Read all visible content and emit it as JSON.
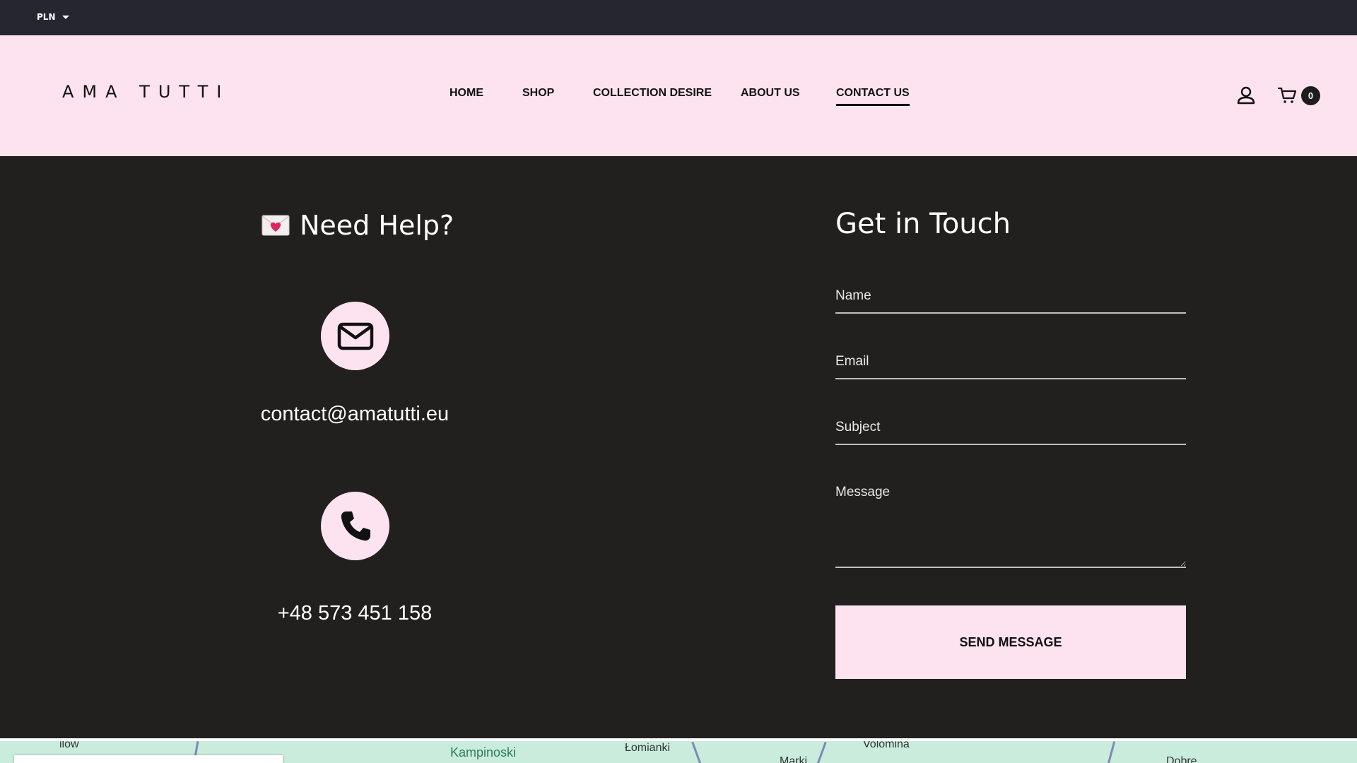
{
  "topbar": {
    "currency": "PLN"
  },
  "header": {
    "logo": "AMA TUTTI",
    "nav": [
      {
        "label": "HOME"
      },
      {
        "label": "SHOP"
      },
      {
        "label": "COLLECTION DESIRE"
      },
      {
        "label": "ABOUT US"
      },
      {
        "label": "CONTACT US",
        "active": true
      }
    ],
    "cart_count": "0"
  },
  "help": {
    "title": "Need Help?",
    "email": "contact@amatutti.eu",
    "phone": "+48 573 451 158"
  },
  "form": {
    "title": "Get in Touch",
    "name_placeholder": "Name",
    "email_placeholder": "Email",
    "subject_placeholder": "Subject",
    "message_placeholder": "Message",
    "submit_label": "SEND MESSAGE"
  },
  "map": {
    "labels": [
      "ilow",
      "Kampinoski",
      "Łomianki",
      "Volomina",
      "Marki",
      "Dobre"
    ]
  },
  "colors": {
    "page_bg": "#221f1f",
    "topbar_bg": "#252630",
    "header_bg": "#fde3f0",
    "accent_pink": "#fde3f0"
  }
}
